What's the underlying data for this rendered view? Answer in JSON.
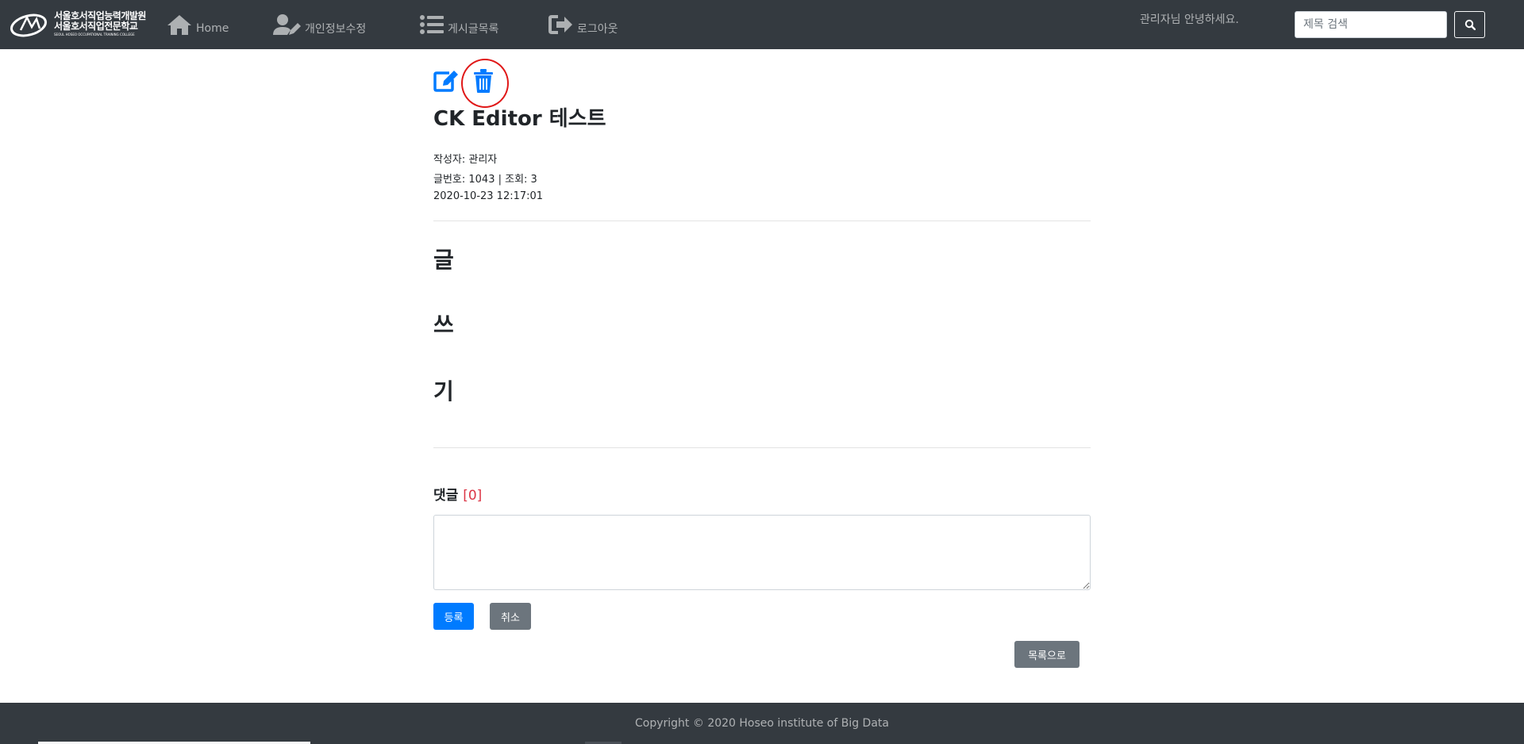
{
  "brand": {
    "logo_line1": "서울호서직업능력개발원",
    "logo_line2": "서울호서직업전문학교",
    "logo_sub": "SEOUL HOSEO OCCUPATIONAL TRAINING COLLEGE"
  },
  "nav": {
    "home": "Home",
    "profile": "개인정보수정",
    "board_list": "게시글목록",
    "logout": "로그아웃",
    "greeting": "관리자님 안녕하세요."
  },
  "search": {
    "placeholder": "제목 검색"
  },
  "post": {
    "title": "CK Editor 테스트",
    "author": "작성자: 관리자",
    "number_views": "글번호: 1043 | 조회: 3",
    "date": "2020-10-23 12:17:01",
    "body_lines": [
      "글",
      "쓰",
      "기"
    ]
  },
  "comments": {
    "label": "댓글",
    "count": "[0]",
    "submit_label": "등록",
    "cancel_label": "취소"
  },
  "back_to_list": "목록으로",
  "footer": {
    "copyright": "Copyright © 2020 Hoseo institute of Big Data"
  },
  "colors": {
    "navbar": "#343a40",
    "primary": "#007bff",
    "secondary": "#6c757d",
    "danger": "#dc3545",
    "annotation_circle": "#e01818"
  },
  "icons": [
    "logo-icon",
    "home-icon",
    "user-edit-icon",
    "list-icon",
    "sign-out-icon",
    "search-icon",
    "edit-icon",
    "trash-icon"
  ]
}
